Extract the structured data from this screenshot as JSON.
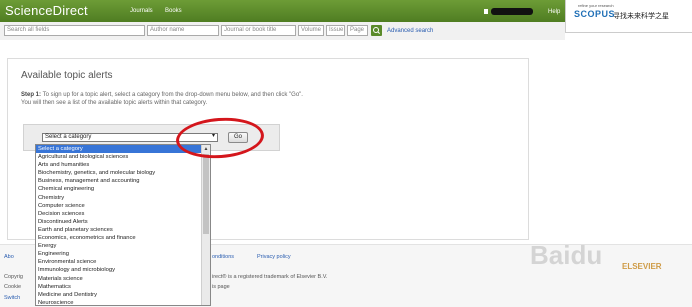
{
  "header": {
    "brand": "ScienceDirect",
    "nav": [
      "Journals",
      "Books"
    ],
    "help": "Help"
  },
  "promo": {
    "tagline": "refine your research",
    "logo": "SCOPUS",
    "chinese_text": "寻找未来科学之星"
  },
  "search": {
    "all_fields_placeholder": "Search all fields",
    "author_placeholder": "Author name",
    "journal_placeholder": "Journal or book title",
    "volume_placeholder": "Volume",
    "issue_placeholder": "Issue",
    "page_placeholder": "Page",
    "advanced_link": "Advanced search",
    "search_icon": "search-icon"
  },
  "main": {
    "title": "Available topic alerts",
    "step_label": "Step 1:",
    "step_line1": " To sign up for a topic alert, select a category from the drop-down menu below, and then click \"Go\".",
    "step_line2": "You will then see a list of the available topic alerts within that category.",
    "select_value": "Select a category",
    "go_label": "Go"
  },
  "dropdown": {
    "selected_index": 0,
    "options": [
      "Select a category",
      "Agricultural and biological sciences",
      "Arts and humanities",
      "Biochemistry, genetics, and molecular biology",
      "Business, management and accounting",
      "Chemical engineering",
      "Chemistry",
      "Computer science",
      "Decision sciences",
      "Discontinued Alerts",
      "Earth and planetary sciences",
      "Economics, econometrics and finance",
      "Energy",
      "Engineering",
      "Environmental science",
      "Immunology and microbiology",
      "Materials science",
      "Mathematics",
      "Medicine and Dentistry",
      "Neuroscience"
    ]
  },
  "footer": {
    "about": "Abo",
    "conditions": "onditions",
    "privacy": "Privacy policy",
    "copyright": "Copyrig",
    "cookies": "Cookie",
    "switch": "Switch",
    "trademark": "irect® is a registered trademark of Elsevier B.V.",
    "page_fragment": "is page"
  },
  "watermark": {
    "text": "Baidu",
    "sub": "ELSEVIER"
  },
  "colors": {
    "header_green": "#5e8f2c",
    "select_highlight": "#3875d7",
    "annotation_red": "#d4161c"
  }
}
